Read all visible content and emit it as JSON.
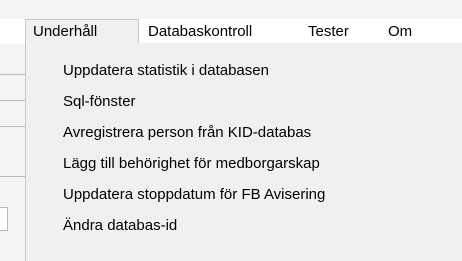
{
  "menubar": {
    "items": [
      {
        "label": "Underhåll"
      },
      {
        "label": "Databaskontroll"
      },
      {
        "label": "Tester"
      },
      {
        "label": "Om"
      }
    ]
  },
  "dropdown": {
    "items": [
      {
        "label": "Uppdatera statistik i databasen"
      },
      {
        "label": "Sql-fönster"
      },
      {
        "label": "Avregistrera person från KID-databas"
      },
      {
        "label": "Lägg till behörighet för medborgarskap"
      },
      {
        "label": "Uppdatera stoppdatum för FB Avisering"
      },
      {
        "label": "Ändra databas-id"
      }
    ]
  },
  "colors": {
    "menubar_background": "#ffffff",
    "dropdown_background": "#f0f0f0",
    "border": "#c7c7c7"
  }
}
